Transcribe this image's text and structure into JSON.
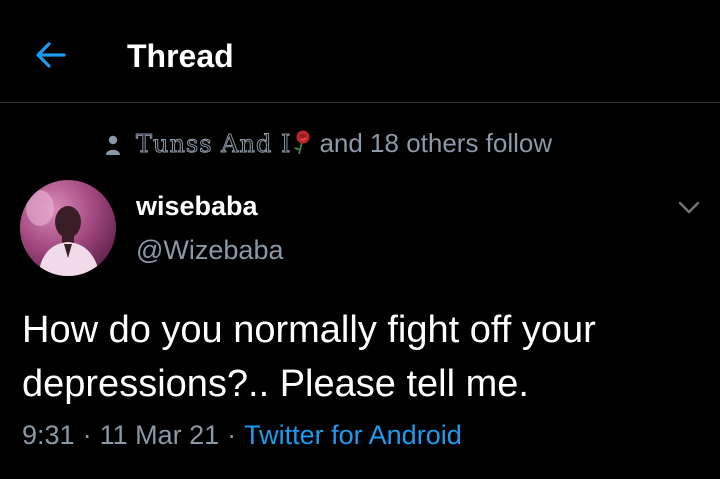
{
  "header": {
    "title": "Thread",
    "back_icon": "arrow-left-icon",
    "accent_color": "#1d9bf0"
  },
  "social_context": {
    "icon": "person-icon",
    "names": "Tunss And I",
    "emoji": "rose-icon",
    "suffix": "and 18 others follow"
  },
  "tweet": {
    "author": {
      "display_name": "wisebaba",
      "handle": "@Wizebaba"
    },
    "text": "How do you normally fight off your depressions?.. Please tell me.",
    "time": "9:31",
    "date": "11 Mar 21",
    "source": "Twitter for Android",
    "separator": "·"
  },
  "colors": {
    "background": "#000000",
    "primary_text": "#ffffff",
    "secondary_text": "#8b98a5",
    "link": "#1d9bf0",
    "divider": "#2f3336"
  }
}
